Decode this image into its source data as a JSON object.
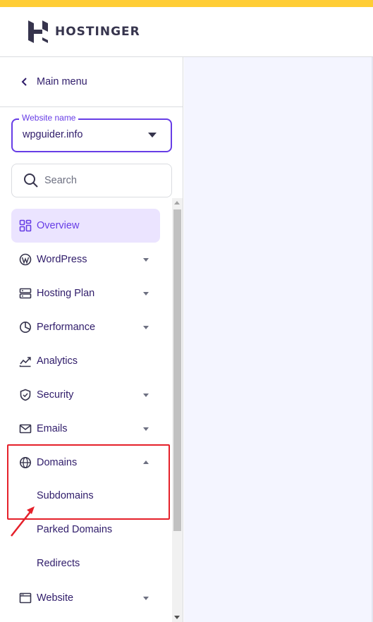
{
  "brand": {
    "name": "HOSTINGER",
    "accent": "#673de6",
    "topbar_color": "#ffcd35"
  },
  "sidebar": {
    "main_menu_label": "Main menu",
    "website_select": {
      "legend": "Website name",
      "value": "wpguider.info"
    },
    "search": {
      "placeholder": "Search"
    },
    "items": [
      {
        "label": "Overview",
        "icon": "grid-icon",
        "active": true
      },
      {
        "label": "WordPress",
        "icon": "wordpress-icon",
        "expandable": true
      },
      {
        "label": "Hosting Plan",
        "icon": "server-icon",
        "expandable": true
      },
      {
        "label": "Performance",
        "icon": "pie-chart-icon",
        "expandable": true
      },
      {
        "label": "Analytics",
        "icon": "trend-line-icon"
      },
      {
        "label": "Security",
        "icon": "shield-icon",
        "expandable": true
      },
      {
        "label": "Emails",
        "icon": "envelope-icon",
        "expandable": true
      },
      {
        "label": "Domains",
        "icon": "globe-icon",
        "expandable": true,
        "expanded": true,
        "children": [
          {
            "label": "Subdomains"
          },
          {
            "label": "Parked Domains"
          },
          {
            "label": "Redirects"
          }
        ]
      },
      {
        "label": "Website",
        "icon": "browser-window-icon",
        "expandable": true
      }
    ]
  },
  "annotation": {
    "highlight_color": "#e5202a"
  }
}
